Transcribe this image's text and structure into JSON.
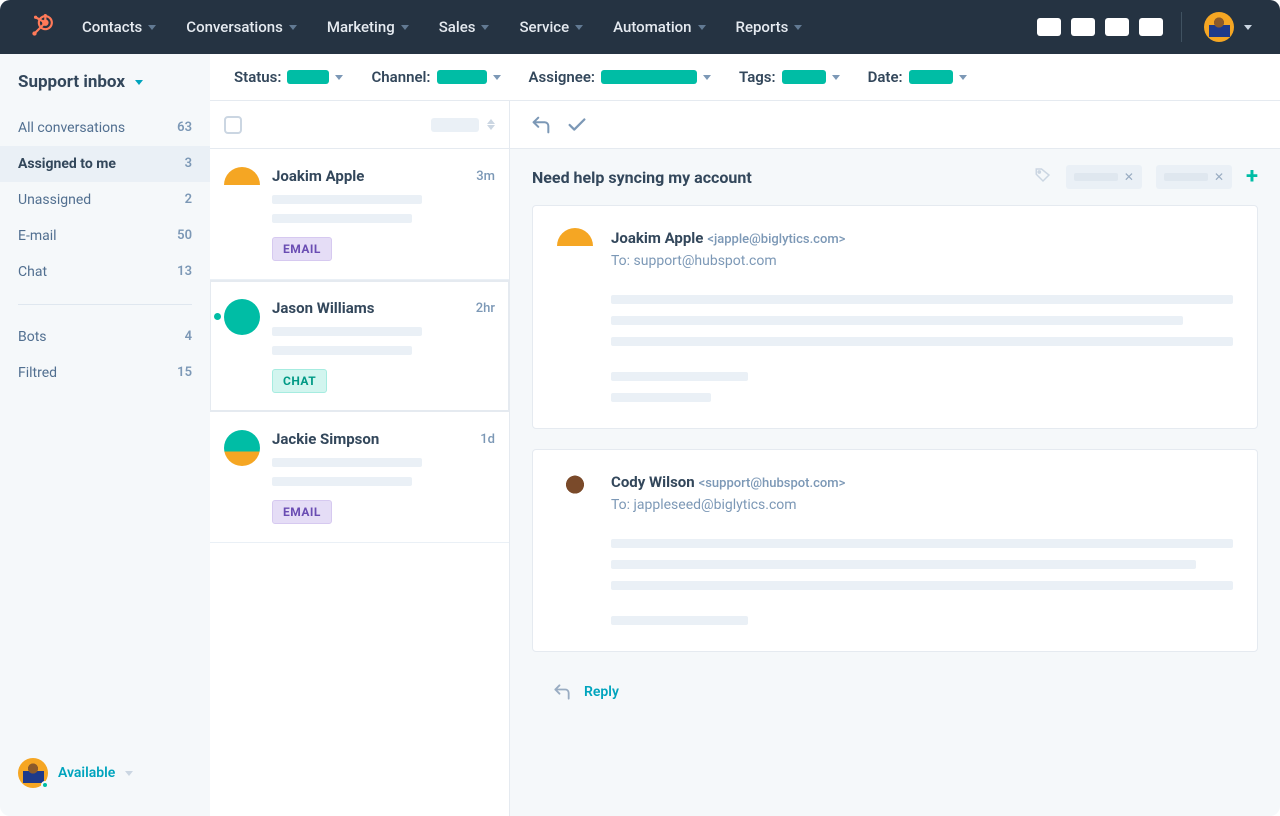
{
  "nav": {
    "items": [
      "Contacts",
      "Conversations",
      "Marketing",
      "Sales",
      "Service",
      "Automation",
      "Reports"
    ]
  },
  "filters": {
    "status": "Status:",
    "channel": "Channel:",
    "assignee": "Assignee:",
    "tags": "Tags:",
    "date": "Date:"
  },
  "sidebar": {
    "title": "Support inbox",
    "items": [
      {
        "label": "All conversations",
        "count": "63"
      },
      {
        "label": "Assigned to me",
        "count": "3"
      },
      {
        "label": "Unassigned",
        "count": "2"
      },
      {
        "label": "E-mail",
        "count": "50"
      },
      {
        "label": "Chat",
        "count": "13"
      }
    ],
    "items2": [
      {
        "label": "Bots",
        "count": "4"
      },
      {
        "label": "Filtred",
        "count": "15"
      }
    ],
    "status": "Available"
  },
  "conversations": [
    {
      "name": "Joakim Apple",
      "time": "3m",
      "badge": "EMAIL",
      "unread": false
    },
    {
      "name": "Jason Williams",
      "time": "2hr",
      "badge": "CHAT",
      "unread": true
    },
    {
      "name": "Jackie Simpson",
      "time": "1d",
      "badge": "EMAIL",
      "unread": false
    }
  ],
  "detail": {
    "subject": "Need help syncing my account",
    "messages": [
      {
        "from": "Joakim Apple",
        "email": "<japple@biglytics.com>",
        "to": "To: support@hubspot.com"
      },
      {
        "from": "Cody Wilson",
        "email": "<support@hubspot.com>",
        "to": "To: jappleseed@biglytics.com"
      }
    ],
    "reply": "Reply"
  }
}
